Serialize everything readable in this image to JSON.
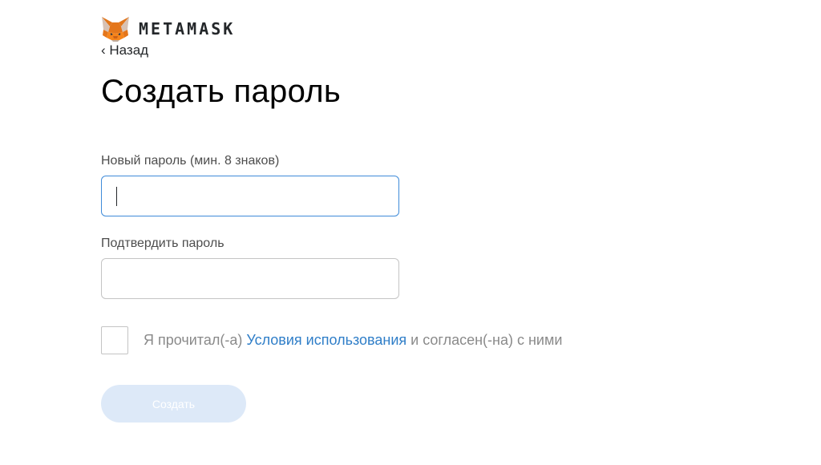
{
  "brand": {
    "wordmark": "METAMASK",
    "logo_icon": "metamask-fox-icon"
  },
  "nav": {
    "back_label": "‹ Назад"
  },
  "page": {
    "title": "Создать пароль"
  },
  "form": {
    "new_password": {
      "label": "Новый пароль (мин. 8 знаков)",
      "value": "",
      "focused": true
    },
    "confirm_password": {
      "label": "Подтвердить пароль",
      "value": ""
    },
    "terms": {
      "checked": false,
      "text_before": "Я прочитал(-а) ",
      "link_text": "Условия использования",
      "text_after": " и согласен(-на) с ними"
    },
    "submit": {
      "label": "Создать",
      "disabled": true
    }
  },
  "colors": {
    "accent": "#3f8bd9",
    "link": "#2f7ec8",
    "button_disabled_bg": "#dde9f8",
    "fox_orange": "#e2761b"
  }
}
